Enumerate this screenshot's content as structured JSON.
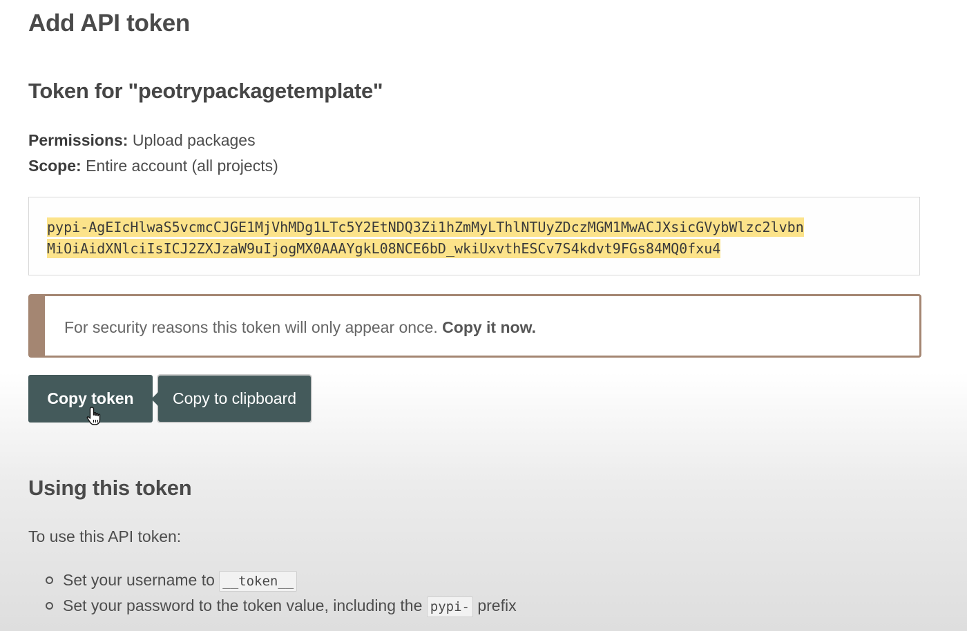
{
  "page": {
    "title": "Add API token"
  },
  "token_section": {
    "heading": "Token for \"peotrypackagetemplate\"",
    "permissions_label": "Permissions:",
    "permissions_value": " Upload packages",
    "scope_label": "Scope:",
    "scope_value": " Entire account (all projects)",
    "token_line_1": "pypi-AgEIcHlwaS5vcmcCJGE1MjVhMDg1LTc5Y2EtNDQ3Zi1hZmMyLThlNTUyZDczMGM1MwACJXsicGVybWlzc2lvbn",
    "token_line_2": "MiOiAidXNlciIsICJ2ZXJzaW9uIjogMX0AAAYgkL08NCE6bD_wkiUxvthESCv7S4kdvt9FGs84MQ0fxu4",
    "highlight_color": "#fce38a"
  },
  "warning": {
    "text": "For security reasons this token will only appear once. ",
    "emphasis": "Copy it now.",
    "accent_color": "#a48672"
  },
  "actions": {
    "copy_label": "Copy token",
    "tooltip": "Copy to clipboard",
    "button_color": "#445a5b"
  },
  "usage": {
    "heading": "Using this token",
    "intro": "To use this API token:",
    "items": [
      {
        "prefix": "Set your username to ",
        "code": "__token__",
        "suffix": ""
      },
      {
        "prefix": "Set your password to the token value, including the ",
        "code": "pypi-",
        "suffix": " prefix"
      }
    ]
  },
  "icons": {
    "cursor": "hand-pointer-icon",
    "bullet": "hollow-circle-bullet-icon"
  }
}
